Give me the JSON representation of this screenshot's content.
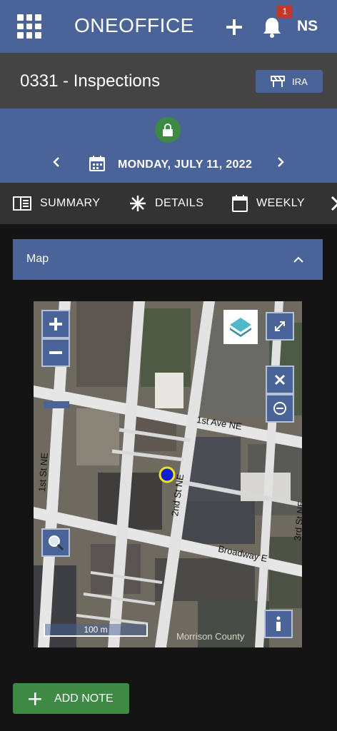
{
  "header": {
    "app_title": "ONEOFFICE",
    "notification_count": "1",
    "user_initials": "NS",
    "accent_color": "#4a6499"
  },
  "project": {
    "title": "0331 - Inspections",
    "ira_label": "IRA"
  },
  "date_nav": {
    "date": "MONDAY, JULY 11, 2022",
    "locked": true
  },
  "tabs": [
    {
      "label": "SUMMARY",
      "icon": "summary-icon"
    },
    {
      "label": "DETAILS",
      "icon": "asterisk-icon"
    },
    {
      "label": "WEEKLY",
      "icon": "calendar-icon"
    },
    {
      "label": "",
      "icon": "tools-icon"
    }
  ],
  "map_section": {
    "header": "Map",
    "streets": [
      "1st Ave NE",
      "1st St NE",
      "2nd St NE",
      "Broadway E",
      "3rd St NE"
    ],
    "scale": "100 m",
    "watermarks": [
      "Morrison County"
    ]
  },
  "actions": {
    "add_note_label": "ADD NOTE",
    "add_note_color": "#3d8a44"
  }
}
